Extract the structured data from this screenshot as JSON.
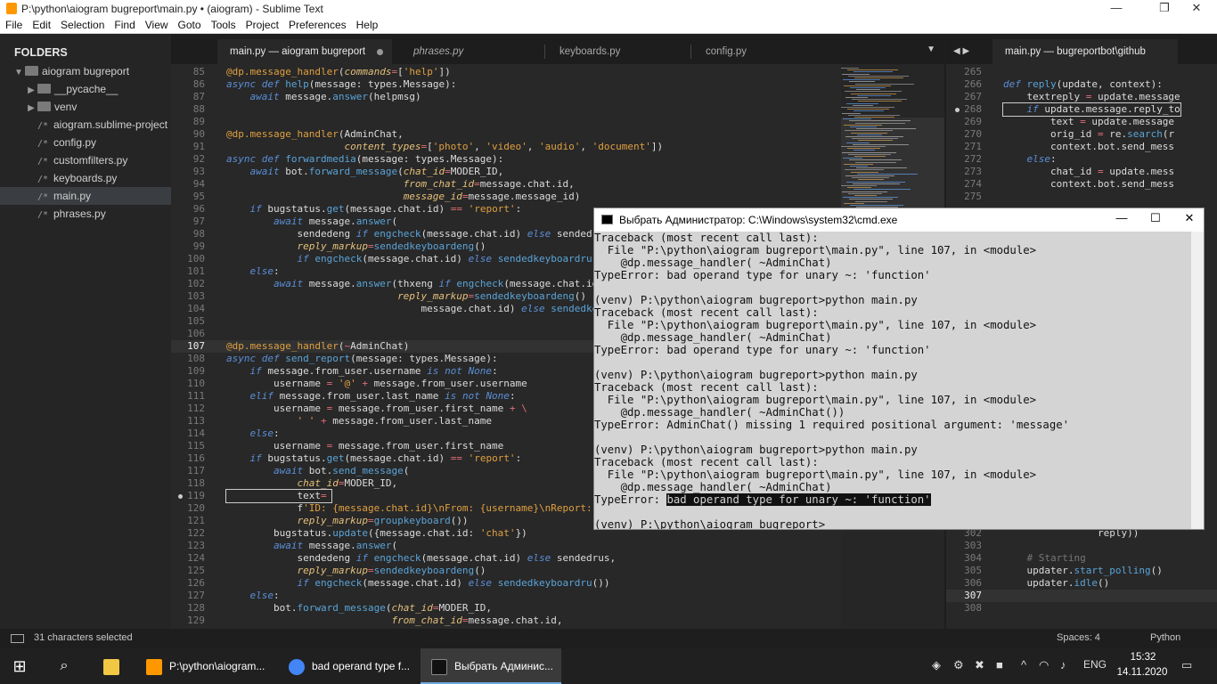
{
  "window": {
    "title": "P:\\python\\aiogram bugreport\\main.py • (aiogram) - Sublime Text",
    "minimize": "—",
    "maximize": "❐",
    "close": "✕"
  },
  "menu": [
    "File",
    "Edit",
    "Selection",
    "Find",
    "View",
    "Goto",
    "Tools",
    "Project",
    "Preferences",
    "Help"
  ],
  "sidebar": {
    "header": "FOLDERS",
    "nav": "◀ ▶",
    "items": [
      {
        "label": "aiogram bugreport",
        "type": "folder-open"
      },
      {
        "label": "__pycache__",
        "type": "folder"
      },
      {
        "label": "venv",
        "type": "folder"
      },
      {
        "label": "aiogram.sublime-project",
        "type": "file"
      },
      {
        "label": "config.py",
        "type": "file"
      },
      {
        "label": "customfilters.py",
        "type": "file"
      },
      {
        "label": "keyboards.py",
        "type": "file"
      },
      {
        "label": "main.py",
        "type": "file",
        "selected": true
      },
      {
        "label": "phrases.py",
        "type": "file"
      }
    ]
  },
  "tabs": [
    {
      "label": "main.py — aiogram bugreport",
      "active": true,
      "dirty": true
    },
    {
      "label": "phrases.py",
      "italic": true
    },
    {
      "label": "keyboards.py"
    },
    {
      "label": "config.py"
    }
  ],
  "tabs_overflow": "▼",
  "right_tab": {
    "label": "main.py — bugreportbot\\github",
    "nav": "◀ ▶"
  },
  "code_lines": [
    {
      "n": "85",
      "t": "@dp.message_handler(commands=['help'])"
    },
    {
      "n": "86",
      "t": "async def help(message: types.Message):"
    },
    {
      "n": "87",
      "t": "    await message.answer(helpmsg)"
    },
    {
      "n": "88",
      "t": ""
    },
    {
      "n": "89",
      "t": ""
    },
    {
      "n": "90",
      "t": "@dp.message_handler(AdminChat,"
    },
    {
      "n": "91",
      "t": "                    content_types=['photo', 'video', 'audio', 'document'])"
    },
    {
      "n": "92",
      "t": "async def forwardmedia(message: types.Message):"
    },
    {
      "n": "93",
      "t": "    await bot.forward_message(chat_id=MODER_ID,"
    },
    {
      "n": "94",
      "t": "                              from_chat_id=message.chat.id,"
    },
    {
      "n": "95",
      "t": "                              message_id=message.message_id)"
    },
    {
      "n": "96",
      "t": "    if bugstatus.get(message.chat.id) == 'report':"
    },
    {
      "n": "97",
      "t": "        await message.answer("
    },
    {
      "n": "98",
      "t": "            sendedeng if engcheck(message.chat.id) else sendedrus,"
    },
    {
      "n": "99",
      "t": "            reply_markup=sendedkeyboardeng()"
    },
    {
      "n": "100",
      "t": "            if engcheck(message.chat.id) else sendedkeyboardru())"
    },
    {
      "n": "101",
      "t": "    else:"
    },
    {
      "n": "102",
      "t": "        await message.answer(thxeng if engcheck(message.chat.id) else thxrus,"
    },
    {
      "n": "103",
      "t": "                             reply_markup=sendedkeyboardeng()"
    },
    {
      "n": "104",
      "t": "                                 message.chat.id) else sendedkeyboardru())"
    },
    {
      "n": "105",
      "t": ""
    },
    {
      "n": "106",
      "t": ""
    },
    {
      "n": "107",
      "t": "@dp.message_handler(~AdminChat)",
      "cur": true
    },
    {
      "n": "108",
      "t": "async def send_report(message: types.Message):"
    },
    {
      "n": "109",
      "t": "    if message.from_user.username is not None:"
    },
    {
      "n": "110",
      "t": "        username = '@' + message.from_user.username"
    },
    {
      "n": "111",
      "t": "    elif message.from_user.last_name is not None:"
    },
    {
      "n": "112",
      "t": "        username = message.from_user.first_name + \\"
    },
    {
      "n": "113",
      "t": "            ' ' + message.from_user.last_name"
    },
    {
      "n": "114",
      "t": "    else:"
    },
    {
      "n": "115",
      "t": "        username = message.from_user.first_name"
    },
    {
      "n": "116",
      "t": "    if bugstatus.get(message.chat.id) == 'report':"
    },
    {
      "n": "117",
      "t": "        await bot.send_message("
    },
    {
      "n": "118",
      "t": "            chat_id=MODER_ID,"
    },
    {
      "n": "119",
      "t": "            text=",
      "mark": true
    },
    {
      "n": "120",
      "t": "            f'ID: {message.chat.id}\\nFrom: {username}\\nReport: {message.text}',"
    },
    {
      "n": "121",
      "t": "            reply_markup=groupkeyboard())"
    },
    {
      "n": "122",
      "t": "        bugstatus.update({message.chat.id: 'chat'})"
    },
    {
      "n": "123",
      "t": "        await message.answer("
    },
    {
      "n": "124",
      "t": "            sendedeng if engcheck(message.chat.id) else sendedrus,"
    },
    {
      "n": "125",
      "t": "            reply_markup=sendedkeyboardeng()"
    },
    {
      "n": "126",
      "t": "            if engcheck(message.chat.id) else sendedkeyboardru())"
    },
    {
      "n": "127",
      "t": "    else:"
    },
    {
      "n": "128",
      "t": "        bot.forward_message(chat_id=MODER_ID,"
    },
    {
      "n": "129",
      "t": "                            from_chat_id=message.chat.id,"
    }
  ],
  "right_lines": [
    {
      "n": "265",
      "t": ""
    },
    {
      "n": "266",
      "t": "def reply(update, context):"
    },
    {
      "n": "267",
      "t": "    textreply = update.message"
    },
    {
      "n": "268",
      "t": "    if update.message.reply_to",
      "mark": true
    },
    {
      "n": "269",
      "t": "        text = update.message"
    },
    {
      "n": "270",
      "t": "        orig_id = re.search(r"
    },
    {
      "n": "271",
      "t": "        context.bot.send_mess"
    },
    {
      "n": "272",
      "t": "    else:"
    },
    {
      "n": "273",
      "t": "        chat_id = update.mess"
    },
    {
      "n": "274",
      "t": "        context.bot.send_mess"
    },
    {
      "n": "275",
      "t": ""
    }
  ],
  "right_lines_bottom": [
    {
      "n": "302",
      "t": "                reply))"
    },
    {
      "n": "303",
      "t": ""
    },
    {
      "n": "304",
      "t": "    # Starting"
    },
    {
      "n": "305",
      "t": "    updater.start_polling()"
    },
    {
      "n": "306",
      "t": "    updater.idle()"
    },
    {
      "n": "307",
      "t": "",
      "cur": true
    },
    {
      "n": "308",
      "t": ""
    }
  ],
  "cmd": {
    "title": "Выбрать Администратор: C:\\Windows\\system32\\cmd.exe",
    "min": "—",
    "max": "☐",
    "close": "✕",
    "lines": [
      "Traceback (most recent call last):",
      "  File \"P:\\python\\aiogram bugreport\\main.py\", line 107, in <module>",
      "    @dp.message_handler( ~AdminChat)",
      "TypeError: bad operand type for unary ~: 'function'",
      "",
      "(venv) P:\\python\\aiogram bugreport>python main.py",
      "Traceback (most recent call last):",
      "  File \"P:\\python\\aiogram bugreport\\main.py\", line 107, in <module>",
      "    @dp.message_handler( ~AdminChat)",
      "TypeError: bad operand type for unary ~: 'function'",
      "",
      "(venv) P:\\python\\aiogram bugreport>python main.py",
      "Traceback (most recent call last):",
      "  File \"P:\\python\\aiogram bugreport\\main.py\", line 107, in <module>",
      "    @dp.message_handler( ~AdminChat())",
      "TypeError: AdminChat() missing 1 required positional argument: 'message'",
      "",
      "(venv) P:\\python\\aiogram bugreport>python main.py",
      "Traceback (most recent call last):",
      "  File \"P:\\python\\aiogram bugreport\\main.py\", line 107, in <module>",
      "    @dp.message_handler( ~AdminChat)"
    ],
    "last_error_prefix": "TypeError: ",
    "last_error_selected": "bad operand type for unary ~: 'function'",
    "prompt": "(venv) P:\\python\\aiogram bugreport>_"
  },
  "status": {
    "selection": "31 characters selected",
    "spaces": "Spaces: 4",
    "syntax": "Python"
  },
  "taskbar": {
    "items": [
      {
        "label": "P:\\python\\aiogram...",
        "color": "#ff9800"
      },
      {
        "label": "bad operand type f...",
        "color": "#4285f4"
      },
      {
        "label": "Выбрать Админис...",
        "color": "#111111",
        "active": true
      }
    ],
    "lang": "ENG",
    "time": "15:32",
    "date": "14.11.2020"
  }
}
